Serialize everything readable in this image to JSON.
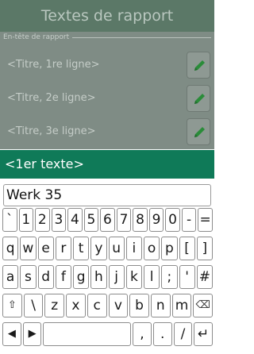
{
  "header": {
    "title": "Textes de rapport"
  },
  "section": {
    "label": "En-tête de rapport"
  },
  "rows": [
    {
      "label": "<Titre, 1re ligne>",
      "button_icon": "pencil-icon"
    },
    {
      "label": "<Titre, 2e ligne>",
      "button_icon": "pencil-icon"
    },
    {
      "label": "<Titre, 3e ligne>",
      "button_icon": "pencil-icon"
    }
  ],
  "active": {
    "label": "<1er texte>"
  },
  "input": {
    "value": "Werk 35"
  },
  "keyboard": {
    "row1": [
      "`",
      "1",
      "2",
      "3",
      "4",
      "5",
      "6",
      "7",
      "8",
      "9",
      "0",
      "-",
      "="
    ],
    "row2": [
      "q",
      "w",
      "e",
      "r",
      "t",
      "y",
      "u",
      "i",
      "o",
      "p",
      "[",
      "]"
    ],
    "row3": [
      "a",
      "s",
      "d",
      "f",
      "g",
      "h",
      "j",
      "k",
      "l",
      ";",
      "'",
      "#"
    ],
    "row4": [
      "⇧",
      "\\",
      "z",
      "x",
      "c",
      "v",
      "b",
      "n",
      "m",
      "⌫"
    ],
    "row5": [
      "◀",
      "▶",
      " ",
      ",",
      ".",
      "/",
      "↵"
    ]
  },
  "colors": {
    "accent": "#0f7a58",
    "pencil": "#2a8c39",
    "dim": "#7f8c85"
  }
}
